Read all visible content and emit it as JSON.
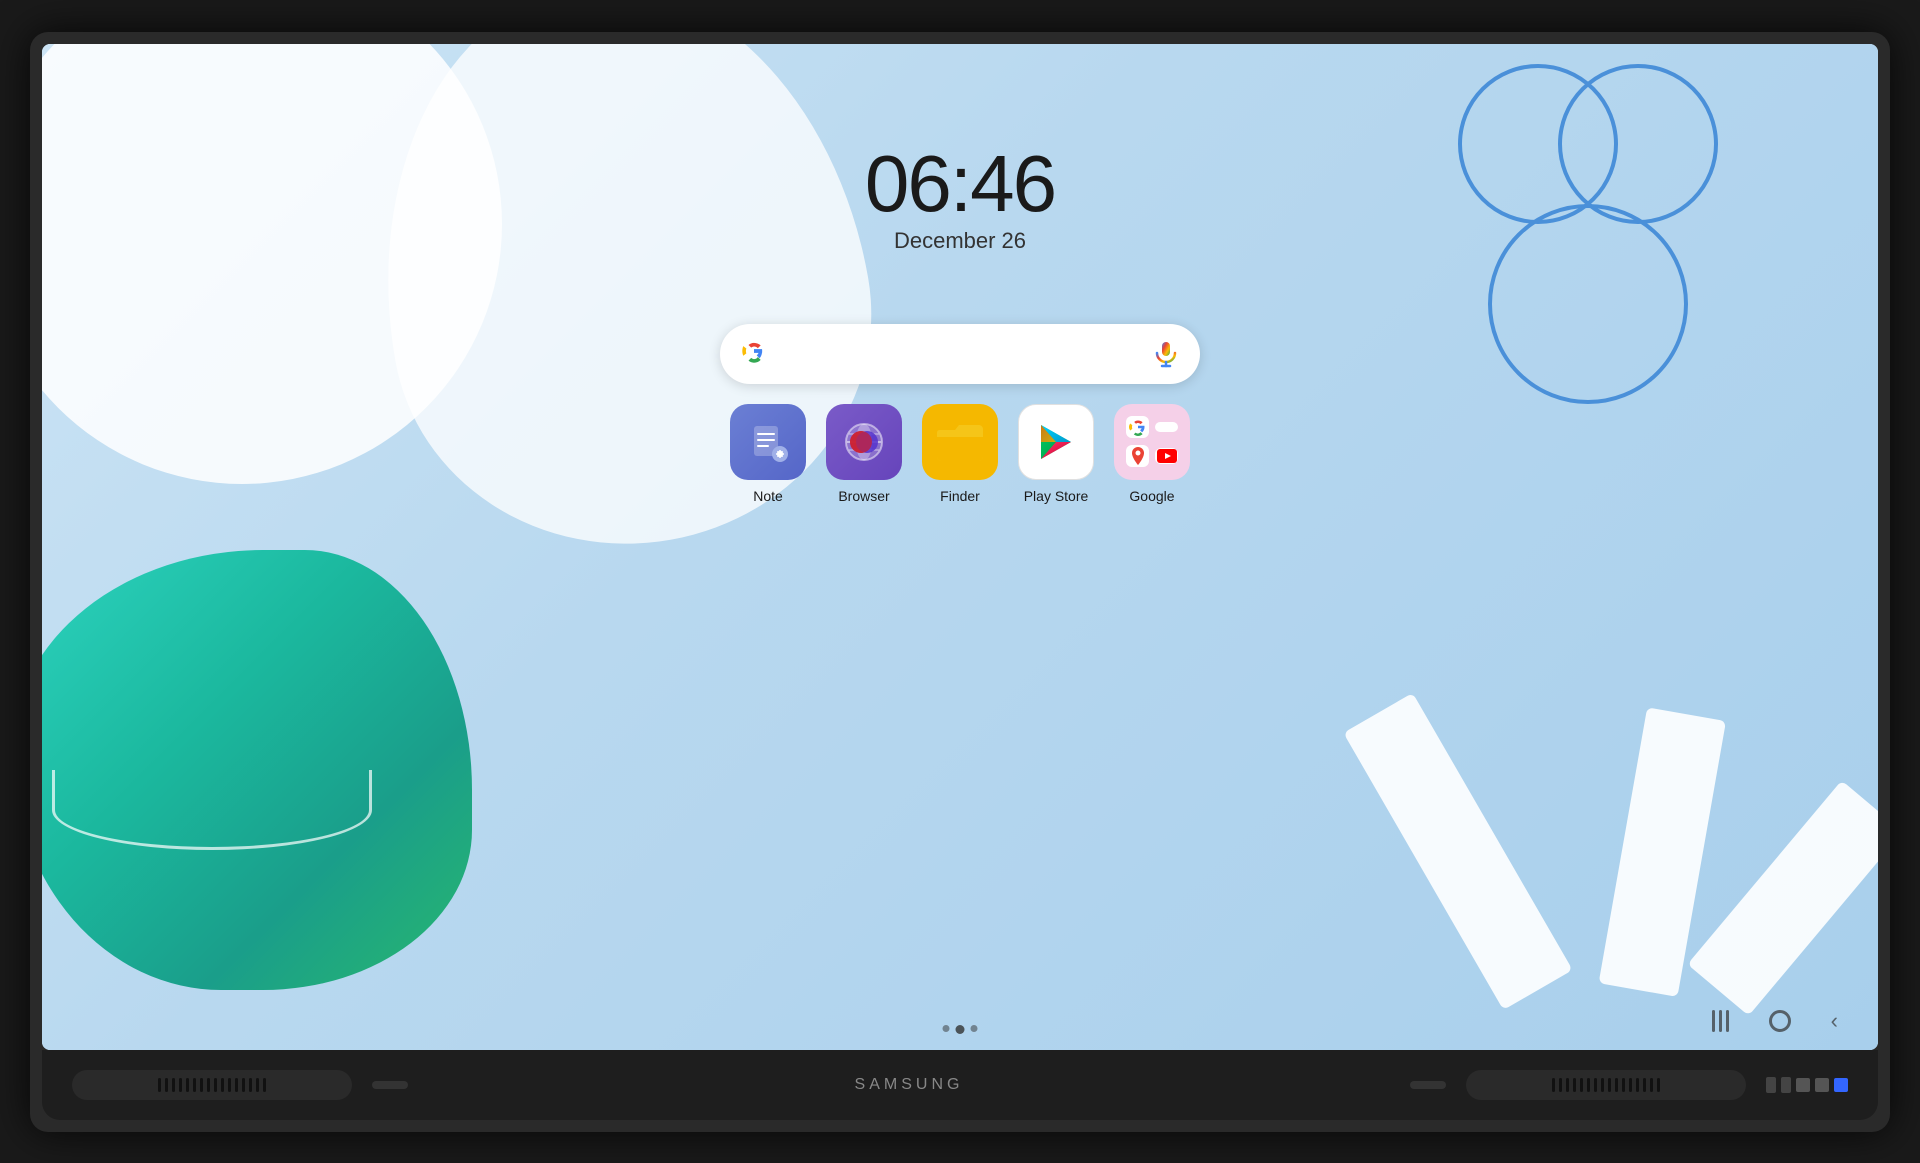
{
  "device": {
    "brand": "SAMSUNG",
    "type": "smart-display"
  },
  "screen": {
    "clock": {
      "time": "06:46",
      "date": "December 26"
    },
    "search": {
      "placeholder": "",
      "brand": "Google"
    },
    "apps": [
      {
        "id": "note",
        "label": "Note",
        "color_from": "#6b7fd4",
        "color_to": "#5566c8"
      },
      {
        "id": "browser",
        "label": "Browser",
        "color_from": "#7a5bc8",
        "color_to": "#6644bb"
      },
      {
        "id": "finder",
        "label": "Finder",
        "color": "#f5b800"
      },
      {
        "id": "playstore",
        "label": "Play Store",
        "color": "#ffffff"
      },
      {
        "id": "google",
        "label": "Google",
        "color": "#f8e8f0"
      }
    ],
    "nav": {
      "recent_label": "|||",
      "home_label": "○",
      "back_label": "‹"
    }
  }
}
